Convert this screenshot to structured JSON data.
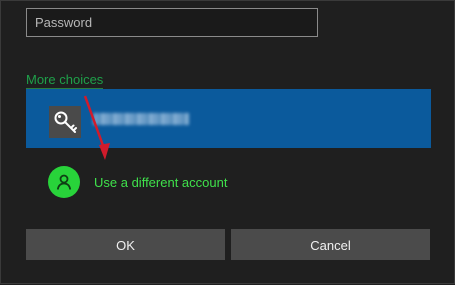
{
  "password": {
    "placeholder": "Password",
    "value": ""
  },
  "more_choices": {
    "label": "More choices"
  },
  "accounts": [
    {
      "name_blurred": "",
      "icon": "key-icon"
    }
  ],
  "different_account": {
    "label": "Use a different account",
    "icon": "user-icon"
  },
  "buttons": {
    "ok": "OK",
    "cancel": "Cancel"
  },
  "colors": {
    "accent_blue": "#0b5a9c",
    "link_green": "#1fa04a",
    "avatar_green": "#28d33a",
    "annotation_red": "#d11b2b"
  }
}
